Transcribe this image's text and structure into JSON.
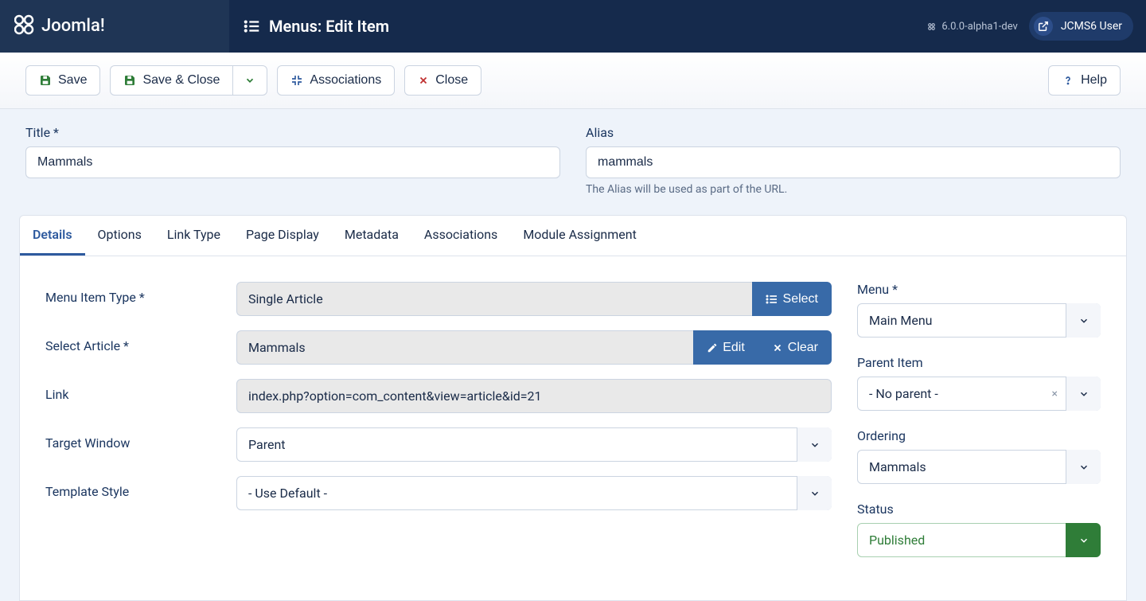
{
  "header": {
    "brand": "Joomla!",
    "pageTitle": "Menus: Edit Item",
    "version": "6.0.0-alpha1-dev",
    "userName": "JCMS6 User"
  },
  "toolbar": {
    "save": "Save",
    "saveClose": "Save & Close",
    "associations": "Associations",
    "close": "Close",
    "help": "Help"
  },
  "titleSection": {
    "titleLabel": "Title *",
    "titleValue": "Mammals",
    "aliasLabel": "Alias",
    "aliasValue": "mammals",
    "aliasHelp": "The Alias will be used as part of the URL."
  },
  "tabs": [
    "Details",
    "Options",
    "Link Type",
    "Page Display",
    "Metadata",
    "Associations",
    "Module Assignment"
  ],
  "details": {
    "menuItemType": {
      "label": "Menu Item Type *",
      "value": "Single Article",
      "selectBtn": "Select"
    },
    "selectArticle": {
      "label": "Select Article *",
      "value": "Mammals",
      "editBtn": "Edit",
      "clearBtn": "Clear"
    },
    "link": {
      "label": "Link",
      "value": "index.php?option=com_content&view=article&id=21"
    },
    "targetWindow": {
      "label": "Target Window",
      "value": "Parent"
    },
    "templateStyle": {
      "label": "Template Style",
      "value": "- Use Default -"
    }
  },
  "sidebar": {
    "menu": {
      "label": "Menu *",
      "value": "Main Menu"
    },
    "parentItem": {
      "label": "Parent Item",
      "value": "- No parent -"
    },
    "ordering": {
      "label": "Ordering",
      "value": "Mammals"
    },
    "status": {
      "label": "Status",
      "value": "Published"
    }
  }
}
